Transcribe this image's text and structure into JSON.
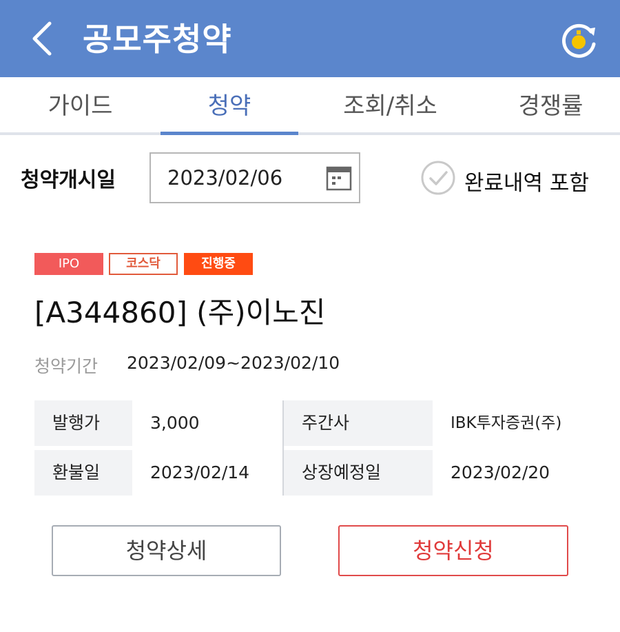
{
  "app_bar": {
    "title": "공모주청약",
    "back_icon": "chevron-left-icon",
    "refresh_icon": "refresh-icon",
    "background_color": "#5b86cc"
  },
  "tabs": [
    {
      "label": "가이드",
      "active": false
    },
    {
      "label": "청약",
      "active": true
    },
    {
      "label": "조회/취소",
      "active": false
    },
    {
      "label": "경쟁률",
      "active": false
    }
  ],
  "filter": {
    "date_label": "청약개시일",
    "date_value": "2023/02/06",
    "calendar_icon": "calendar-icon",
    "include_completed_label": "완료내역 포함",
    "include_completed_checked": false
  },
  "offering": {
    "badges": [
      {
        "text": "IPO",
        "color": "#f25a5a"
      },
      {
        "text": "코스닥",
        "color": "#e15a3b"
      },
      {
        "text": "진행중",
        "color": "#ff4b12"
      }
    ],
    "name": "[A344860] (주)이노진",
    "period_label": "청약기간",
    "period_value": "2023/02/09~2023/02/10",
    "info": {
      "issue_price_label": "발행가",
      "issue_price_value": "3,000",
      "underwriter_label": "주간사",
      "underwriter_value": "IBK투자증권(주)",
      "refund_date_label": "환불일",
      "refund_date_value": "2023/02/14",
      "listing_date_label": "상장예정일",
      "listing_date_value": "2023/02/20"
    },
    "detail_button": "청약상세",
    "apply_button": "청약신청"
  }
}
